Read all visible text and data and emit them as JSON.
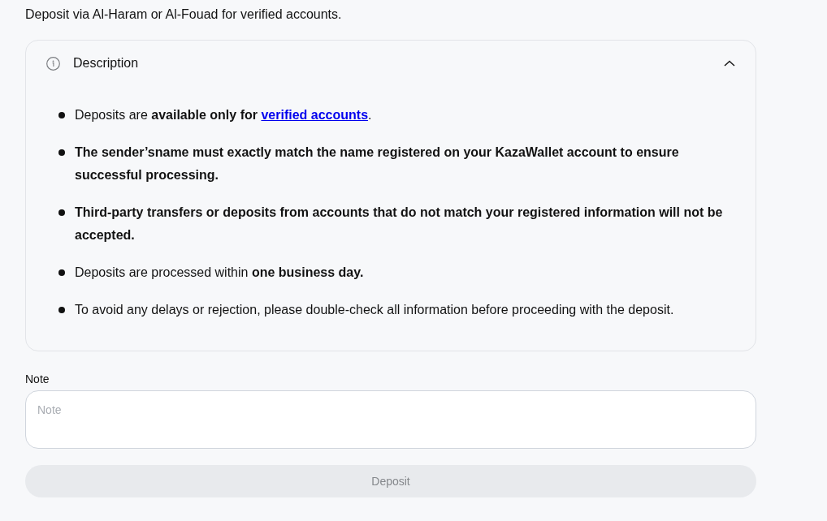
{
  "intro": "Deposit via Al-Haram or Al-Fouad for verified accounts.",
  "description": {
    "title": "Description",
    "expanded": true,
    "items": [
      {
        "bold": false,
        "segments": [
          {
            "kind": "text",
            "text": "Deposits are **available only for** "
          },
          {
            "kind": "link",
            "text": "verified accounts"
          },
          {
            "kind": "text",
            "text": "."
          }
        ]
      },
      {
        "bold": true,
        "segments": [
          {
            "kind": "text",
            "text": "The sender’sname must exactly match the name registered on your KazaWallet account to ensure successful processing."
          }
        ]
      },
      {
        "bold": true,
        "segments": [
          {
            "kind": "text",
            "text": "Third-party transfers or deposits from accounts that do not match your registered information will not be accepted."
          }
        ]
      },
      {
        "bold": false,
        "segments": [
          {
            "kind": "text",
            "text": "Deposits are processed within **one business day.**"
          }
        ]
      },
      {
        "bold": false,
        "segments": [
          {
            "kind": "text",
            "text": "To avoid any delays or rejection, please double-check all information before proceeding with the deposit."
          }
        ]
      }
    ]
  },
  "note": {
    "label": "Note",
    "placeholder": "Note"
  },
  "deposit_button": {
    "label": "Deposit",
    "disabled": true
  }
}
